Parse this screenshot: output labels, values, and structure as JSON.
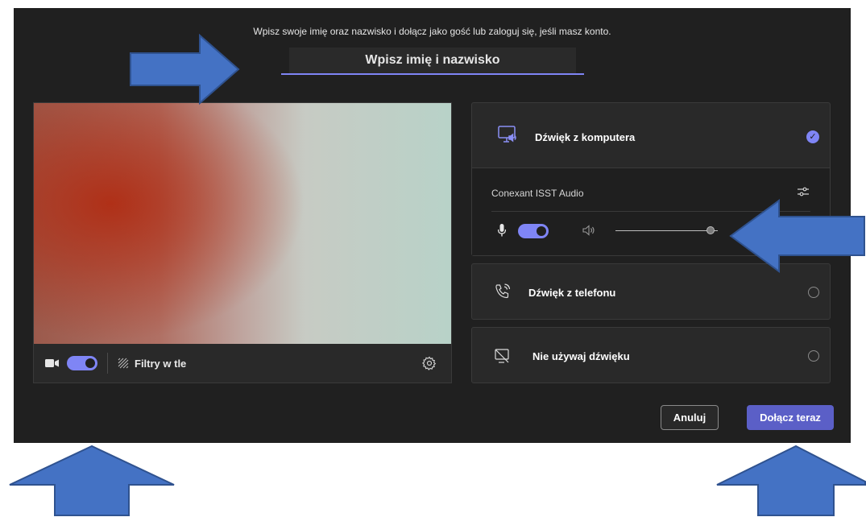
{
  "prompt": "Wpisz swoje imię oraz nazwisko i dołącz jako gość lub zaloguj się, jeśli masz konto.",
  "name_input": {
    "value": "",
    "placeholder": "Wpisz imię i nazwisko"
  },
  "video": {
    "camera_on": true,
    "filters_label": "Filtry w tle",
    "icons": [
      "camera-icon",
      "background-effects-icon",
      "settings-icon"
    ]
  },
  "audio": {
    "computer": {
      "label": "Dźwięk z komputera",
      "selected": true
    },
    "device": {
      "name": "Conexant ISST Audio",
      "mic_on": true,
      "volume": 0.93
    },
    "phone": {
      "label": "Dźwięk z telefonu",
      "selected": false
    },
    "none": {
      "label": "Nie używaj dźwięku",
      "selected": false
    }
  },
  "buttons": {
    "cancel": "Anuluj",
    "join": "Dołącz teraz"
  },
  "colors": {
    "accent": "#7f85f5",
    "join_button": "#5b5fc7",
    "annotation_arrow": "#4472c4",
    "dialog_bg": "#202020"
  }
}
